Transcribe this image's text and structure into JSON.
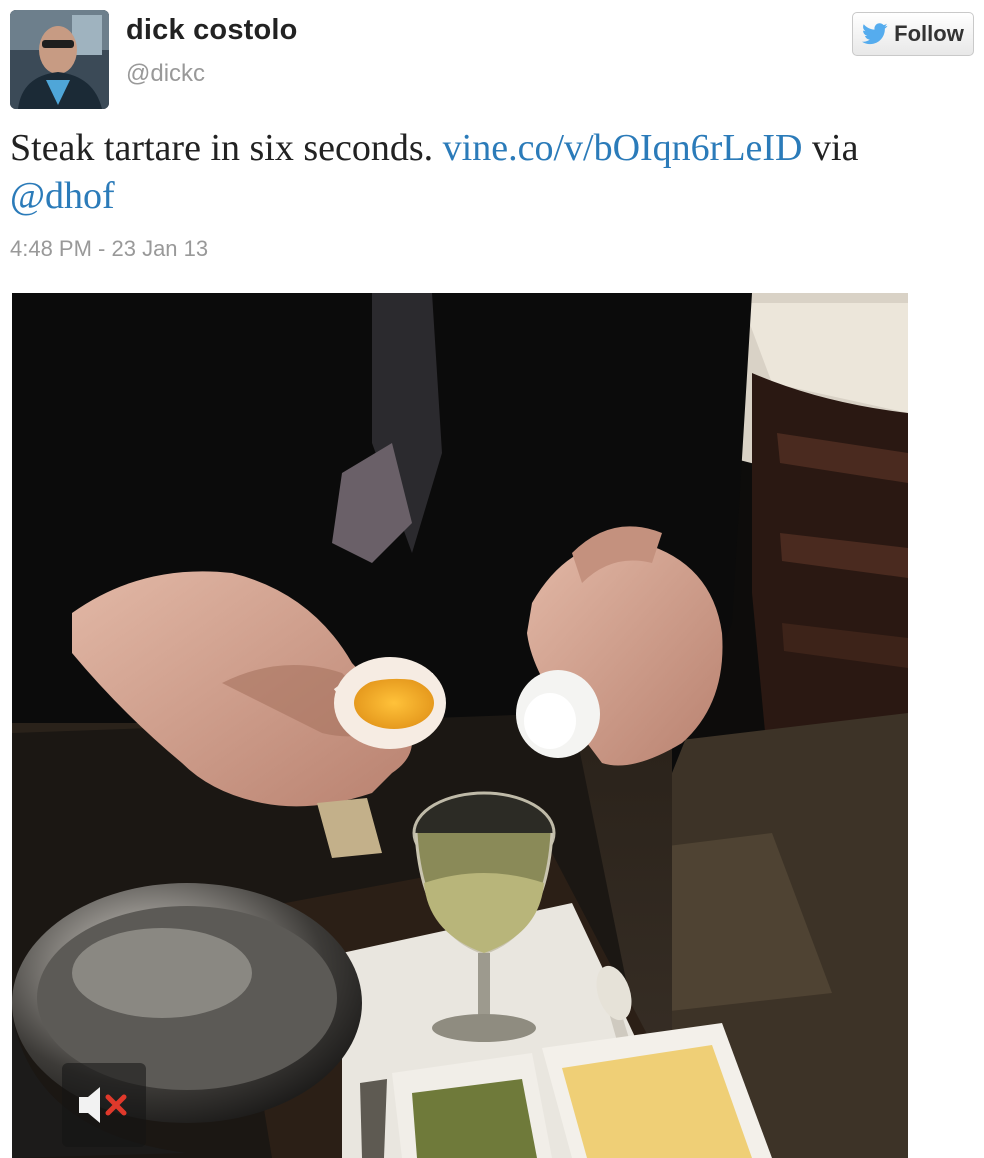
{
  "tweet": {
    "display_name": "dick costolo",
    "screen_name": "@dickc",
    "text_plain": "Steak tartare in six seconds.",
    "link": "vine.co/v/bOIqn6rLeID",
    "via": "via",
    "mention": "@dhof",
    "timestamp": "4:48 PM - 23 Jan 13"
  },
  "follow_button": {
    "label": "Follow",
    "icon": "twitter-bird-icon"
  },
  "media": {
    "mute_icon": "speaker-muted-icon"
  },
  "colors": {
    "link": "#2b7bb9",
    "twitter_blue": "#55acee",
    "muted_x": "#e0392b"
  }
}
